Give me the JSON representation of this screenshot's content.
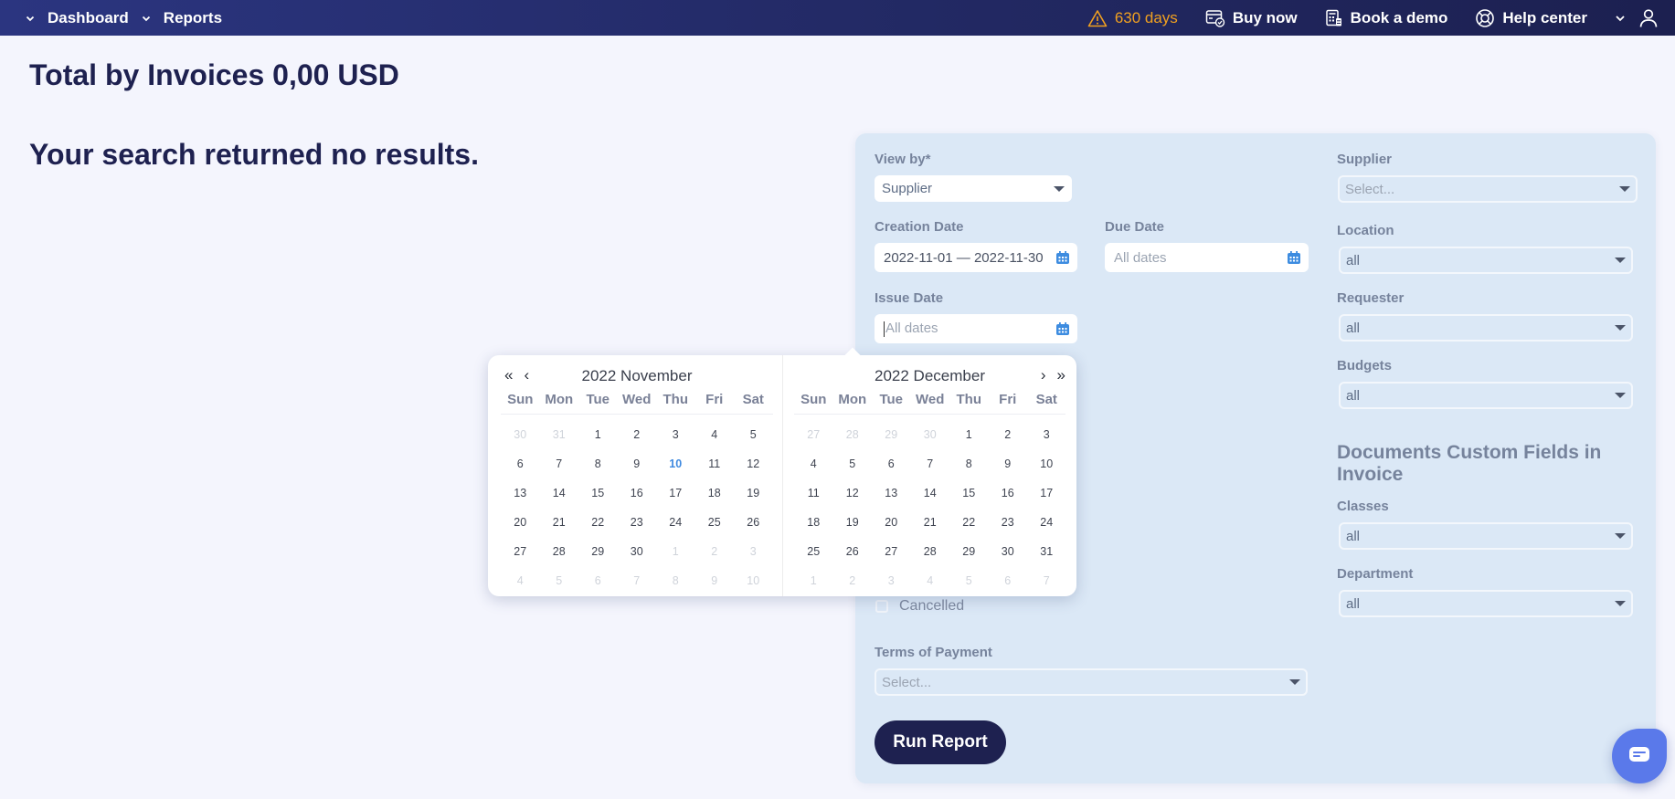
{
  "topnav": {
    "left_items": [
      {
        "label": "Dashboard",
        "icon": "chevron-down-icon"
      },
      {
        "label": "Reports",
        "icon": "chevron-down-icon"
      }
    ],
    "trial": {
      "label": "630 days",
      "icon": "warning-icon",
      "color": "#f0a020"
    },
    "buy_now": {
      "label": "Buy now",
      "icon": "card-shield-icon"
    },
    "book_demo": {
      "label": "Book a demo",
      "icon": "calculator-icon"
    },
    "help_center": {
      "label": "Help center",
      "icon": "lifebuoy-icon"
    },
    "account_menu_icon": "chevron-down-icon",
    "user_icon": "user-icon"
  },
  "main": {
    "title": "Total by Invoices 0,00 USD",
    "empty_message": "Your search returned no results."
  },
  "filters": {
    "view_by": {
      "label": "View by*",
      "value": "Supplier"
    },
    "creation_date": {
      "label": "Creation Date",
      "value": "2022-11-01 — 2022-11-30"
    },
    "due_date": {
      "label": "Due Date",
      "placeholder": "All dates"
    },
    "issue_date": {
      "label": "Issue Date",
      "placeholder": "All dates"
    },
    "cancelled": {
      "label": "Cancelled",
      "checked": false
    },
    "terms_of_payment": {
      "label": "Terms of Payment",
      "placeholder": "Select..."
    },
    "supplier": {
      "label": "Supplier",
      "placeholder": "Select..."
    },
    "location": {
      "label": "Location",
      "value": "all"
    },
    "requester": {
      "label": "Requester",
      "value": "all"
    },
    "budgets": {
      "label": "Budgets",
      "value": "all"
    },
    "custom_fields_title": "Documents Custom Fields in Invoice",
    "classes": {
      "label": "Classes",
      "value": "all"
    },
    "department": {
      "label": "Department",
      "value": "all"
    },
    "run_button": "Run Report"
  },
  "datepicker": {
    "nav": {
      "prev_year": "«",
      "prev_month": "‹",
      "next_month": "›",
      "next_year": "»"
    },
    "weekdays": [
      "Sun",
      "Mon",
      "Tue",
      "Wed",
      "Thu",
      "Fri",
      "Sat"
    ],
    "months": [
      {
        "title": "2022 November",
        "today": 10,
        "days": [
          {
            "d": "30",
            "m": true
          },
          {
            "d": "31",
            "m": true
          },
          {
            "d": "1"
          },
          {
            "d": "2"
          },
          {
            "d": "3"
          },
          {
            "d": "4"
          },
          {
            "d": "5"
          },
          {
            "d": "6"
          },
          {
            "d": "7"
          },
          {
            "d": "8"
          },
          {
            "d": "9"
          },
          {
            "d": "10",
            "t": true
          },
          {
            "d": "11"
          },
          {
            "d": "12"
          },
          {
            "d": "13"
          },
          {
            "d": "14"
          },
          {
            "d": "15"
          },
          {
            "d": "16"
          },
          {
            "d": "17"
          },
          {
            "d": "18"
          },
          {
            "d": "19"
          },
          {
            "d": "20"
          },
          {
            "d": "21"
          },
          {
            "d": "22"
          },
          {
            "d": "23"
          },
          {
            "d": "24"
          },
          {
            "d": "25"
          },
          {
            "d": "26"
          },
          {
            "d": "27"
          },
          {
            "d": "28"
          },
          {
            "d": "29"
          },
          {
            "d": "30"
          },
          {
            "d": "1",
            "m": true
          },
          {
            "d": "2",
            "m": true
          },
          {
            "d": "3",
            "m": true
          },
          {
            "d": "4",
            "m": true
          },
          {
            "d": "5",
            "m": true
          },
          {
            "d": "6",
            "m": true
          },
          {
            "d": "7",
            "m": true
          },
          {
            "d": "8",
            "m": true
          },
          {
            "d": "9",
            "m": true
          },
          {
            "d": "10",
            "m": true
          }
        ]
      },
      {
        "title": "2022 December",
        "days": [
          {
            "d": "27",
            "m": true
          },
          {
            "d": "28",
            "m": true
          },
          {
            "d": "29",
            "m": true
          },
          {
            "d": "30",
            "m": true
          },
          {
            "d": "1"
          },
          {
            "d": "2"
          },
          {
            "d": "3"
          },
          {
            "d": "4"
          },
          {
            "d": "5"
          },
          {
            "d": "6"
          },
          {
            "d": "7"
          },
          {
            "d": "8"
          },
          {
            "d": "9"
          },
          {
            "d": "10"
          },
          {
            "d": "11"
          },
          {
            "d": "12"
          },
          {
            "d": "13"
          },
          {
            "d": "14"
          },
          {
            "d": "15"
          },
          {
            "d": "16"
          },
          {
            "d": "17"
          },
          {
            "d": "18"
          },
          {
            "d": "19"
          },
          {
            "d": "20"
          },
          {
            "d": "21"
          },
          {
            "d": "22"
          },
          {
            "d": "23"
          },
          {
            "d": "24"
          },
          {
            "d": "25"
          },
          {
            "d": "26"
          },
          {
            "d": "27"
          },
          {
            "d": "28"
          },
          {
            "d": "29"
          },
          {
            "d": "30"
          },
          {
            "d": "31"
          },
          {
            "d": "1",
            "m": true
          },
          {
            "d": "2",
            "m": true
          },
          {
            "d": "3",
            "m": true
          },
          {
            "d": "4",
            "m": true
          },
          {
            "d": "5",
            "m": true
          },
          {
            "d": "6",
            "m": true
          },
          {
            "d": "7",
            "m": true
          }
        ]
      }
    ]
  },
  "chat_widget": {
    "icon": "chat-icon"
  },
  "colors": {
    "primary": "#1e2150",
    "accent": "#3f8ae0",
    "panel": "#dbe8f6",
    "warning": "#f0a020"
  }
}
